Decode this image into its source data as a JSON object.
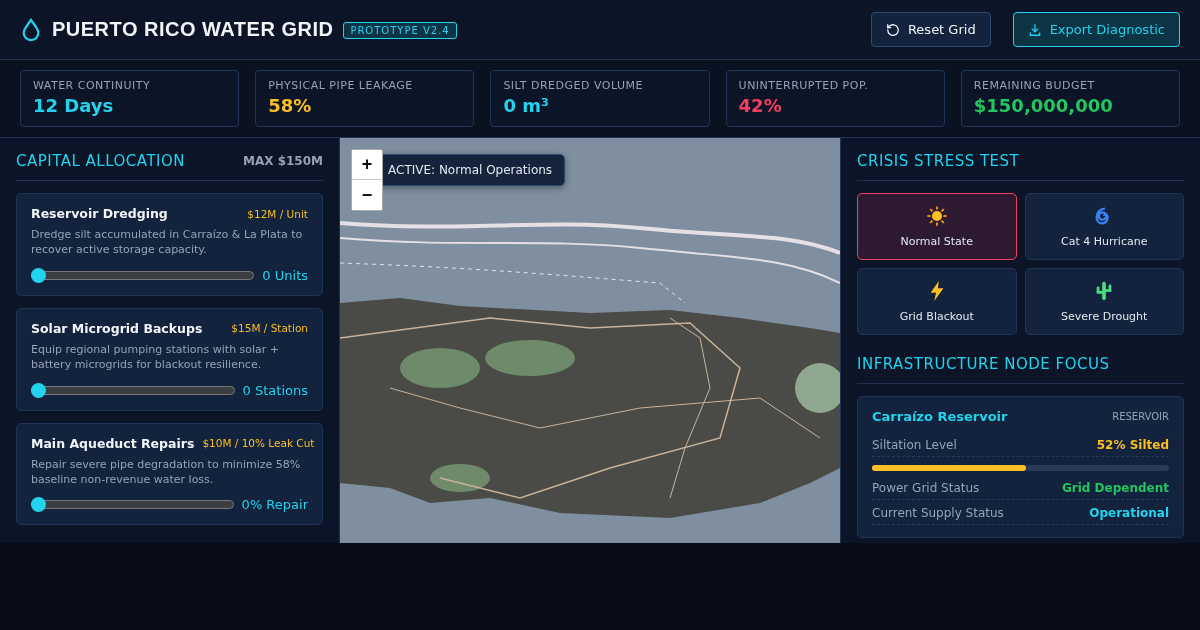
{
  "header": {
    "title": "PUERTO RICO WATER GRID",
    "badge": "PROTOTYPE V2.4",
    "buttons": [
      {
        "kind": "reset",
        "label": "Reset Grid"
      },
      {
        "kind": "export",
        "label": "Export Diagnostic"
      }
    ]
  },
  "kpis": [
    {
      "label": "WATER CONTINUITY",
      "value": "12 Days",
      "color": "#22d3ee"
    },
    {
      "label": "PHYSICAL PIPE LEAKAGE",
      "value": "58%",
      "color": "#fbbf24"
    },
    {
      "label": "SILT DREDGED VOLUME",
      "value": "0 m³",
      "color": "#22d3ee"
    },
    {
      "label": "UNINTERRUPTED POP.",
      "value": "42%",
      "color": "#f43f5e"
    },
    {
      "label": "REMAINING BUDGET",
      "value": "$150,000,000",
      "color": "#22c55e"
    }
  ],
  "allocation": {
    "title": "CAPITAL ALLOCATION",
    "max": "MAX $150M",
    "items": [
      {
        "name": "Reservoir Dredging",
        "cost": "$12M / Unit",
        "description": "Dredge silt accumulated in Carraízo & La Plata to recover active storage capacity.",
        "level": 0,
        "reading": "0 Units"
      },
      {
        "name": "Solar Microgrid Backups",
        "cost": "$15M / Station",
        "description": "Equip regional pumping stations with solar + battery microgrids for blackout resilience.",
        "level": 0,
        "reading": "0 Stations"
      },
      {
        "name": "Main Aqueduct Repairs",
        "cost": "$10M / 10% Leak Cut",
        "description": "Repair severe pipe degradation to minimize 58% baseline non-revenue water loss.",
        "level": 0,
        "reading": "0% Repair"
      }
    ]
  },
  "map": {
    "zoom_in": "+",
    "zoom_out": "−",
    "status": "ACTIVE: Normal Operations",
    "kind": "picture"
  },
  "crisis": {
    "title": "CRISIS STRESS TEST",
    "scenarios": [
      {
        "kind": "sun",
        "label": "Normal State",
        "selected": true
      },
      {
        "kind": "spiral",
        "label": "Cat 4 Hurricane",
        "selected": false
      },
      {
        "kind": "bolt",
        "label": "Grid Blackout",
        "selected": false
      },
      {
        "kind": "cactus",
        "label": "Severe Drought",
        "selected": false
      }
    ]
  },
  "node": {
    "title": "INFRASTRUCTURE NODE FOCUS",
    "name": "Carraízo Reservoir",
    "type": "RESERVOIR",
    "rows": [
      {
        "kind": "meter",
        "label": "Siltation Level",
        "value": "52% Silted",
        "color": "#fbbf24",
        "level": 0.52
      },
      {
        "kind": "text",
        "label": "Power Grid Status",
        "value": "Grid Dependent",
        "color": "#22c55e"
      },
      {
        "kind": "text",
        "label": "Current Supply Status",
        "value": "Operational",
        "color": "#22d3ee"
      }
    ]
  }
}
